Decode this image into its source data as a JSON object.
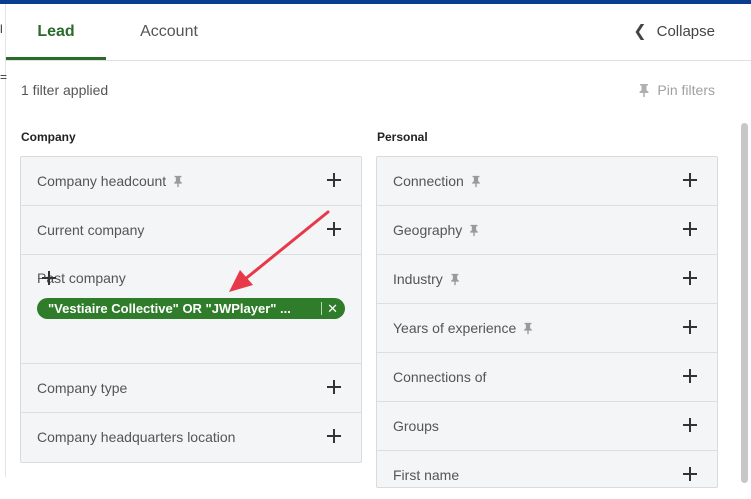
{
  "tabs": [
    {
      "label": "Lead",
      "active": true
    },
    {
      "label": "Account",
      "active": false
    }
  ],
  "collapse_label": "Collapse",
  "filter_status": "1 filter applied",
  "pin_filters_label": "Pin filters",
  "sections": {
    "company": {
      "title": "Company",
      "rows": [
        {
          "label": "Company headcount",
          "pinned": true
        },
        {
          "label": "Current company",
          "pinned": false
        },
        {
          "label": "Past company",
          "pinned": false,
          "chip": "\"Vestiaire Collective\" OR \"JWPlayer\" ..."
        },
        {
          "label": "Company type",
          "pinned": false
        },
        {
          "label": "Company headquarters location",
          "pinned": false
        }
      ]
    },
    "personal": {
      "title": "Personal",
      "rows": [
        {
          "label": "Connection",
          "pinned": true
        },
        {
          "label": "Geography",
          "pinned": true
        },
        {
          "label": "Industry",
          "pinned": true
        },
        {
          "label": "Years of experience",
          "pinned": true
        },
        {
          "label": "Connections of",
          "pinned": false
        },
        {
          "label": "Groups",
          "pinned": false
        },
        {
          "label": "First name",
          "pinned": false
        }
      ]
    }
  },
  "colors": {
    "accent_green": "#2f7d2a",
    "tab_active": "#2a6b2a",
    "arrow": "#e8394a",
    "top_bar": "#0a3d8f"
  },
  "icons": {
    "pin": "pin-icon",
    "add": "plus-icon",
    "remove": "close-icon",
    "collapse": "chevron-left-icon"
  }
}
